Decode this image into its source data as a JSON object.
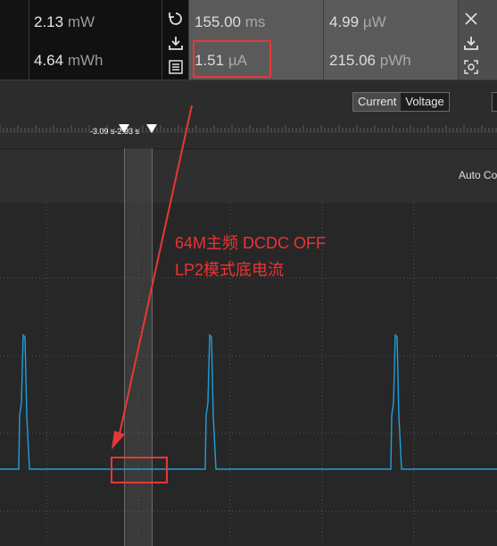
{
  "readout": {
    "left": {
      "power": {
        "value": "2.13",
        "unit": "mW"
      },
      "energy": {
        "value": "4.64",
        "unit": "mWh"
      }
    },
    "selection": {
      "duration": {
        "value": "155.00",
        "unit": "ms"
      },
      "avg_current": {
        "value": "1.51",
        "unit": "µA"
      },
      "avg_power": {
        "value": "4.99",
        "unit": "µW"
      },
      "energy": {
        "value": "215.06",
        "unit": "pWh"
      }
    },
    "icons": [
      "reset-icon",
      "download-icon",
      "list-icon",
      "close-icon",
      "download-icon",
      "screenshot-icon"
    ]
  },
  "mode_toggle": {
    "options": [
      "Current",
      "Voltage"
    ],
    "selected": "Current"
  },
  "timeline": {
    "marker_label": "-3.09 s-2.93 s"
  },
  "chart_header": {
    "right_label": "Auto Co"
  },
  "annotation": {
    "line1": "64M主频 DCDC OFF",
    "line2": "LP2模式底电流",
    "color": "#f03232"
  },
  "colors": {
    "trace": "#1e9fdc",
    "annotation": "#e53935",
    "selection_band": "#4a4a4a"
  }
}
